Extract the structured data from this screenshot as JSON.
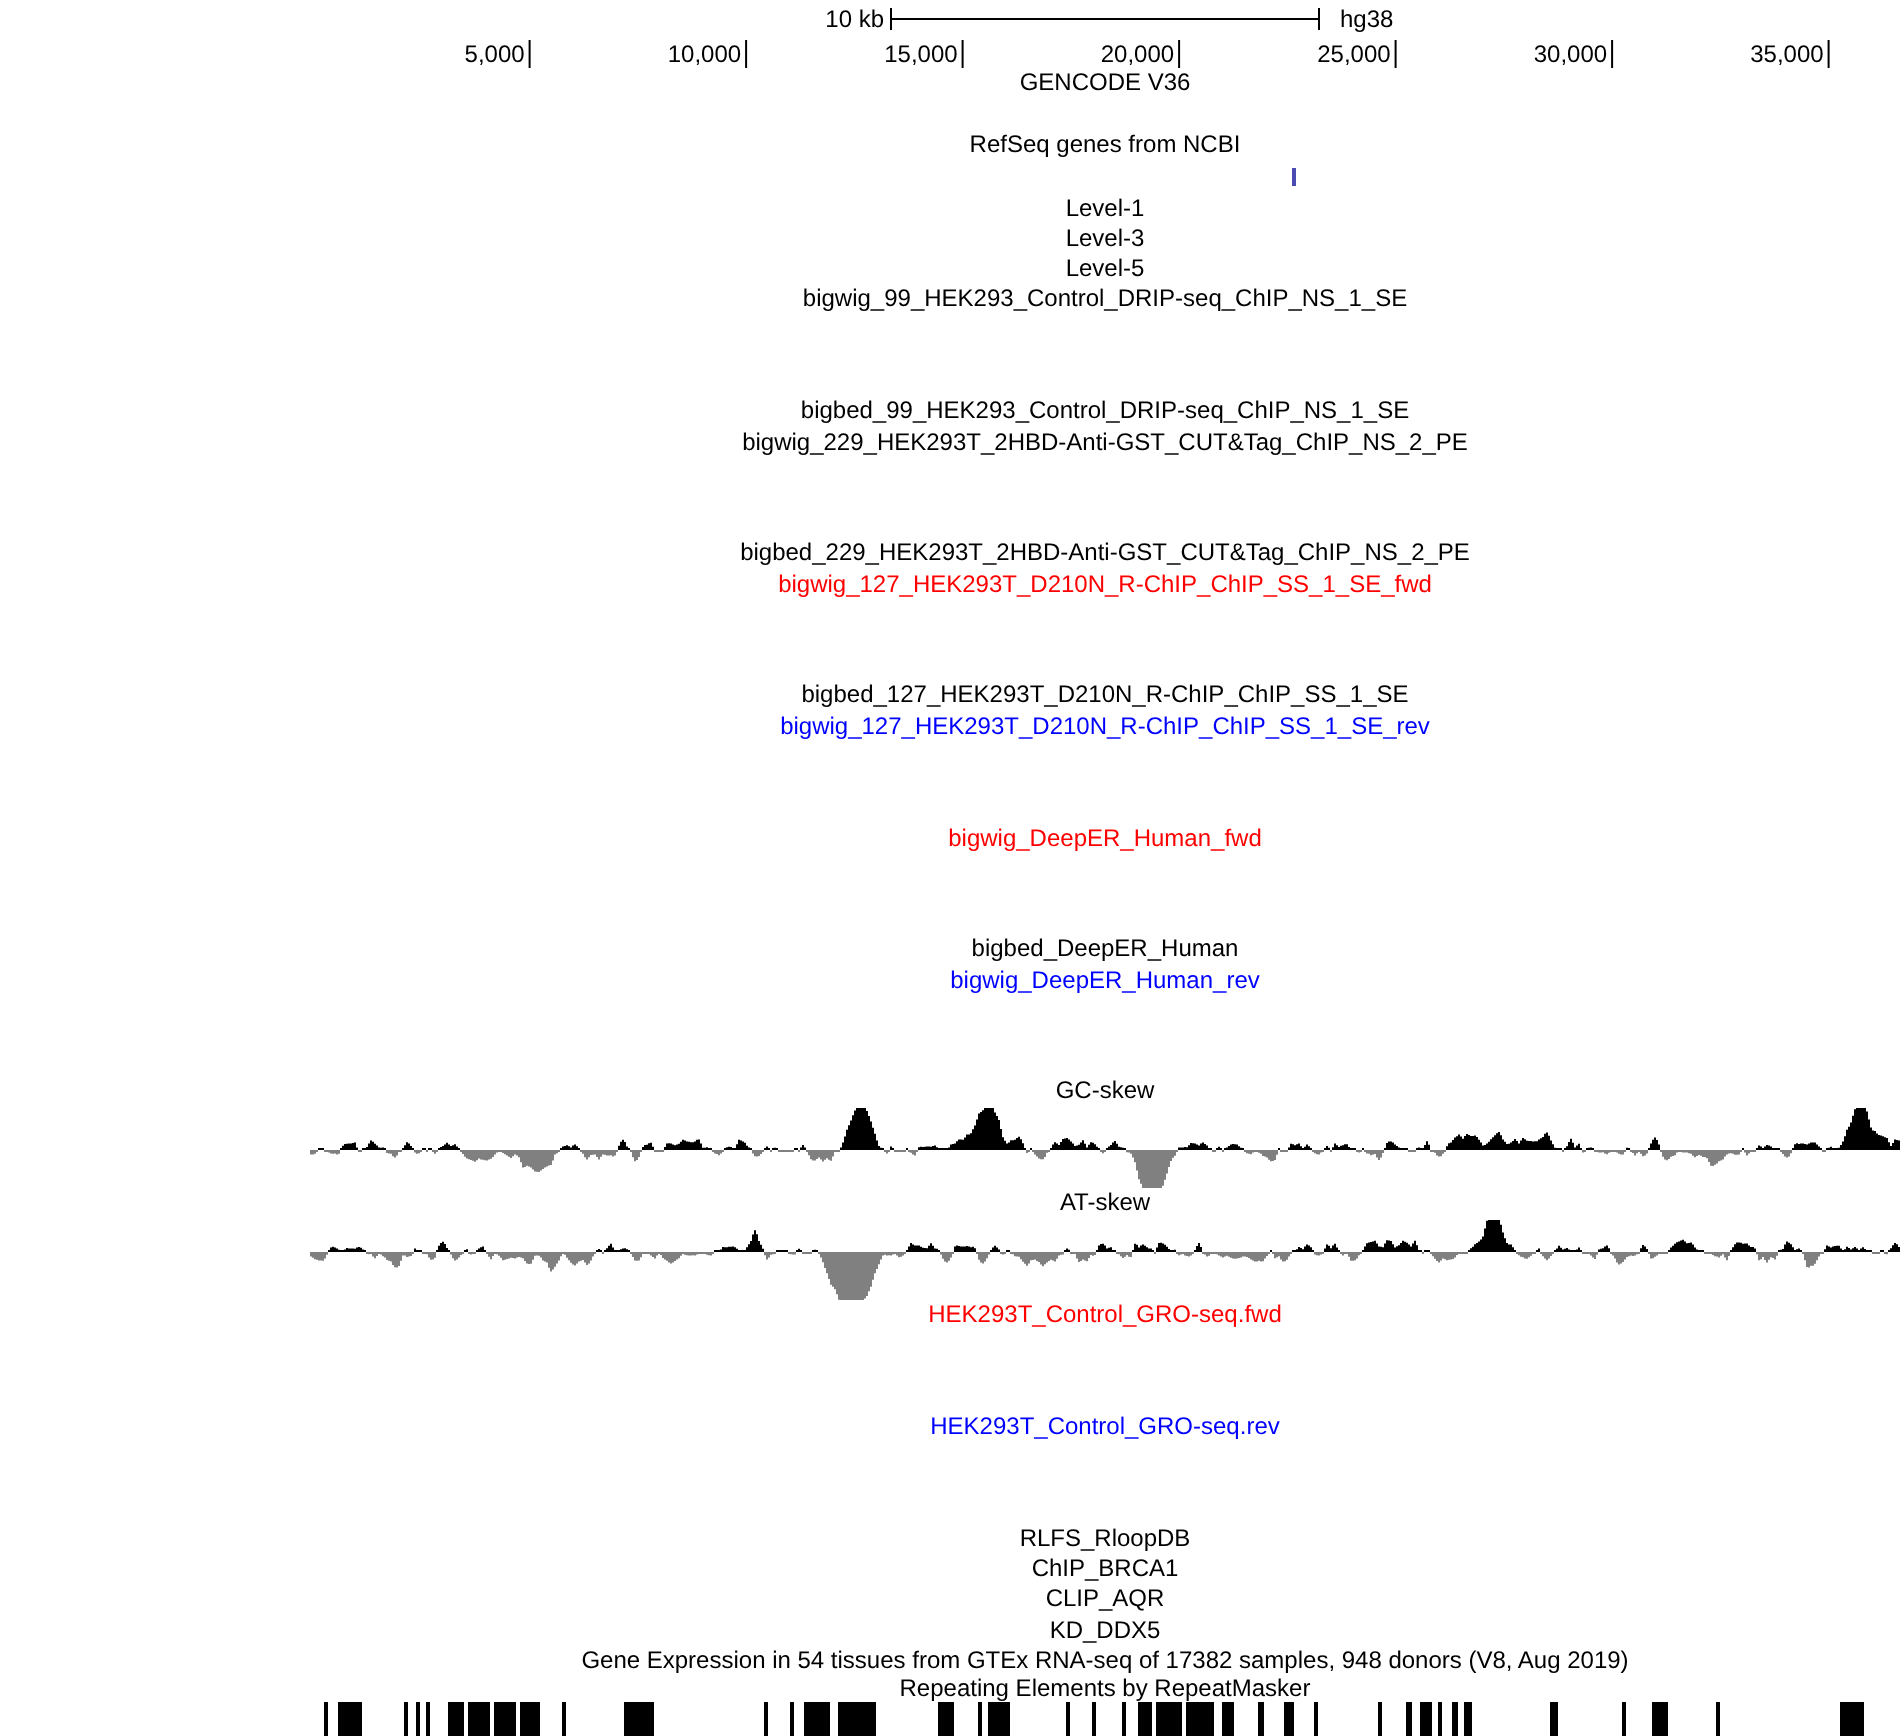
{
  "ruler": {
    "scale": "10 kb",
    "assembly": "hg38",
    "ticks": [
      "5,000",
      "10,000",
      "15,000",
      "20,000",
      "25,000",
      "30,000",
      "35,000"
    ]
  },
  "tracks": [
    {
      "label": "GENCODE V36",
      "kind": "gene",
      "color": "#000000",
      "feature_shown": false
    },
    {
      "label": "RefSeq genes from NCBI",
      "kind": "gene",
      "color": "#000000",
      "feature_shown": true
    },
    {
      "label": "Level-1",
      "kind": "label",
      "color": "#000000"
    },
    {
      "label": "Level-3",
      "kind": "label",
      "color": "#000000"
    },
    {
      "label": "Level-5",
      "kind": "label",
      "color": "#000000"
    },
    {
      "label": "bigwig_99_HEK293_Control_DRIP-seq_ChIP_NS_1_SE",
      "kind": "signal",
      "color": "#000000"
    },
    {
      "label": "bigbed_99_HEK293_Control_DRIP-seq_ChIP_NS_1_SE",
      "kind": "label",
      "color": "#000000"
    },
    {
      "label": "bigwig_229_HEK293T_2HBD-Anti-GST_CUT&Tag_ChIP_NS_2_PE",
      "kind": "signal",
      "color": "#000000"
    },
    {
      "label": "bigbed_229_HEK293T_2HBD-Anti-GST_CUT&Tag_ChIP_NS_2_PE",
      "kind": "label",
      "color": "#000000"
    },
    {
      "label": "bigwig_127_HEK293T_D210N_R-ChIP_ChIP_SS_1_SE_fwd",
      "kind": "signal",
      "color": "#ff0000"
    },
    {
      "label": "bigbed_127_HEK293T_D210N_R-ChIP_ChIP_SS_1_SE",
      "kind": "label",
      "color": "#000000"
    },
    {
      "label": "bigwig_127_HEK293T_D210N_R-ChIP_ChIP_SS_1_SE_rev",
      "kind": "signal",
      "color": "#0000ff"
    },
    {
      "label": "bigwig_DeepER_Human_fwd",
      "kind": "signal",
      "color": "#ff0000"
    },
    {
      "label": "bigbed_DeepER_Human",
      "kind": "label",
      "color": "#000000"
    },
    {
      "label": "bigwig_DeepER_Human_rev",
      "kind": "signal",
      "color": "#0000ff"
    },
    {
      "label": "GC-skew",
      "kind": "gc_skew",
      "color": "#000000"
    },
    {
      "label": "AT-skew",
      "kind": "at_skew",
      "color": "#000000"
    },
    {
      "label": "HEK293T_Control_GRO-seq.fwd",
      "kind": "signal",
      "color": "#ff0000"
    },
    {
      "label": "HEK293T_Control_GRO-seq.rev",
      "kind": "signal",
      "color": "#0000ff"
    },
    {
      "label": "RLFS_RloopDB",
      "kind": "label",
      "color": "#000000"
    },
    {
      "label": "ChIP_BRCA1",
      "kind": "label",
      "color": "#000000"
    },
    {
      "label": "CLIP_AQR",
      "kind": "label",
      "color": "#000000"
    },
    {
      "label": "KD_DDX5",
      "kind": "label",
      "color": "#000000"
    },
    {
      "label": "Gene Expression in 54 tissues from GTEx RNA-seq of 17382 samples, 948 donors (V8, Aug 2019)",
      "kind": "label",
      "color": "#000000"
    },
    {
      "label": "Repeating Elements by RepeatMasker",
      "kind": "repeats",
      "color": "#000000"
    }
  ]
}
